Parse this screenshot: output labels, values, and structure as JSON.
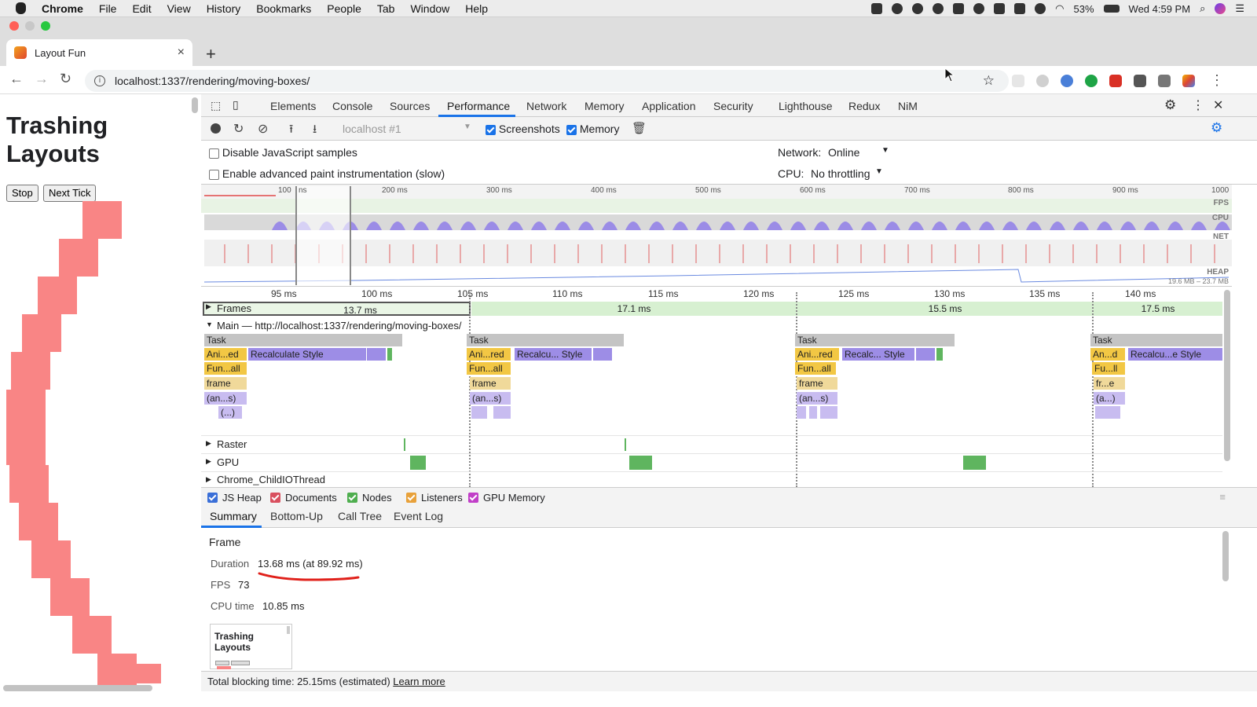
{
  "menubar": {
    "app": "Chrome",
    "items": [
      "File",
      "Edit",
      "View",
      "History",
      "Bookmarks",
      "People",
      "Tab",
      "Window",
      "Help"
    ],
    "battery": "53%",
    "clock": "Wed 4:59 PM"
  },
  "tab": {
    "title": "Layout Fun",
    "close": "×",
    "new_tab": "+"
  },
  "nav": {
    "back": "←",
    "forward": "→",
    "reload": "↻",
    "url": "localhost:1337/rendering/moving-boxes/",
    "star": "☆",
    "menu": "⋮"
  },
  "page": {
    "heading_line1": "Trashing",
    "heading_line2": "Layouts",
    "stop": "Stop",
    "next_tick": "Next Tick"
  },
  "devtools": {
    "tabs": [
      "Elements",
      "Console",
      "Sources",
      "Performance",
      "Network",
      "Memory",
      "Application",
      "Security",
      "Lighthouse",
      "Redux",
      "NiM"
    ],
    "active_tab": "Performance"
  },
  "perf": {
    "target": "localhost #1",
    "screenshots": "Screenshots",
    "memory": "Memory",
    "disable_js": "Disable JavaScript samples",
    "advanced_paint": "Enable advanced paint instrumentation (slow)",
    "network_label": "Network:",
    "network_value": "Online",
    "cpu_label": "CPU:",
    "cpu_value": "No throttling"
  },
  "overview": {
    "ticks": [
      "100",
      "200 ms",
      "300 ms",
      "400 ms",
      "500 ms",
      "600 ms",
      "700 ms",
      "800 ms",
      "900 ms",
      "1000"
    ],
    "fps": "FPS",
    "cpu": "CPU",
    "net": "NET",
    "heap": "HEAP",
    "heap_range": "19.6 MB – 23.7 MB",
    "sel_label": "ns"
  },
  "flame": {
    "ticks": [
      "95 ms",
      "100 ms",
      "105 ms",
      "110 ms",
      "115 ms",
      "120 ms",
      "125 ms",
      "130 ms",
      "135 ms",
      "140 ms"
    ],
    "frames_label": "Frames",
    "frames": [
      "13.7 ms",
      "17.1 ms",
      "15.5 ms",
      "17.5 ms"
    ],
    "main_label": "Main — http://localhost:1337/rendering/moving-boxes/",
    "task": "Task",
    "g1": [
      "Ani...ed",
      "Recalculate Style",
      "Fun...all",
      "frame",
      "(an...s)",
      "(...)"
    ],
    "g2": [
      "Ani...red",
      "Recalcu... Style",
      "Fun...all",
      "frame",
      "(an...s)"
    ],
    "g3": [
      "Ani...red",
      "Recalc... Style",
      "Fun...all",
      "frame",
      "(an...s)"
    ],
    "g4": [
      "An...d",
      "Recalcu...e Style",
      "Fu...ll",
      "fr...e",
      "(a...)"
    ],
    "raster": "Raster",
    "gpu": "GPU",
    "io": "Chrome_ChildIOThread"
  },
  "counters": [
    {
      "label": "JS Heap",
      "color": "#3a6fd8"
    },
    {
      "label": "Documents",
      "color": "#d9505f"
    },
    {
      "label": "Nodes",
      "color": "#4fae4f"
    },
    {
      "label": "Listeners",
      "color": "#e8a13a"
    },
    {
      "label": "GPU Memory",
      "color": "#c13fc8"
    }
  ],
  "bottom_tabs": [
    "Summary",
    "Bottom-Up",
    "Call Tree",
    "Event Log"
  ],
  "summary": {
    "title": "Frame",
    "duration_label": "Duration",
    "duration_value": "13.68 ms (at 89.92 ms)",
    "fps_label": "FPS",
    "fps_value": "73",
    "cpu_label": "CPU time",
    "cpu_value": "10.85 ms",
    "thumb_line1": "Trashing",
    "thumb_line2": "Layouts"
  },
  "footer": {
    "text": "Total blocking time: 25.15ms (estimated)",
    "link": "Learn more"
  }
}
